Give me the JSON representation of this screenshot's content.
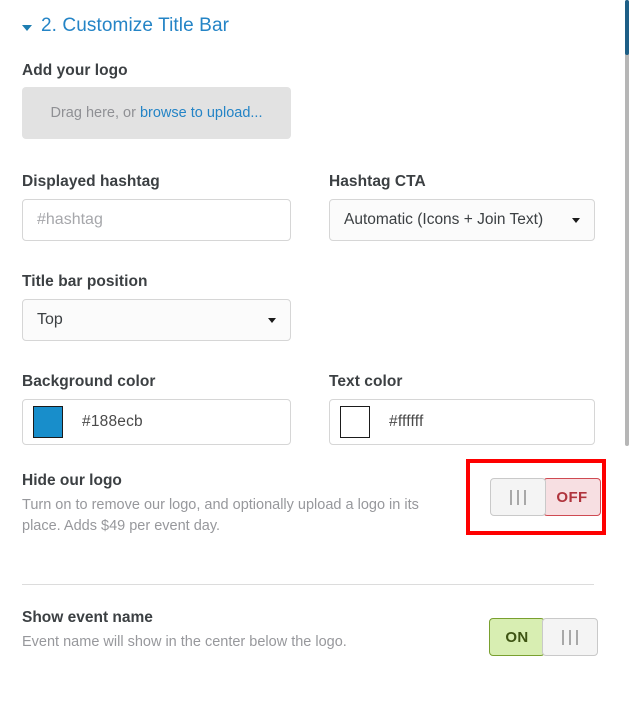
{
  "section": {
    "title": "2. Customize Title Bar",
    "collapse_icon": "caret-down-icon",
    "accent_color": "#2484c6"
  },
  "logo_upload": {
    "label": "Add your logo",
    "prompt_text": "Drag here, or ",
    "link_text": "browse to upload...",
    "background_color": "#e2e2e2"
  },
  "fields": {
    "hashtag": {
      "label": "Displayed hashtag",
      "value": "",
      "placeholder": "#hashtag"
    },
    "hashtag_cta": {
      "label": "Hashtag CTA",
      "value": "Automatic (Icons + Join Text)",
      "options": [
        "Automatic (Icons + Join Text)"
      ]
    },
    "title_bar_position": {
      "label": "Title bar position",
      "value": "Top",
      "options": [
        "Top"
      ]
    },
    "background_color": {
      "label": "Background color",
      "value": "#188ecb",
      "swatch_color": "#188ecb"
    },
    "text_color": {
      "label": "Text color",
      "value": "#ffffff",
      "swatch_color": "#ffffff"
    }
  },
  "toggles": {
    "hide_logo": {
      "title": "Hide our logo",
      "description": "Turn on to remove our logo, and optionally upload a logo in its place. Adds $49 per event day.",
      "state_label": "OFF",
      "state": "off",
      "handle_icon": "grip-handle-icon",
      "off_color": "#f7dfe2",
      "highlighted": true,
      "highlight_color": "#fe0000"
    },
    "show_event_name": {
      "title": "Show event name",
      "description": "Event name will show in the center below the logo.",
      "state_label": "ON",
      "state": "on",
      "handle_icon": "grip-handle-icon",
      "on_color": "#d8eeb2"
    }
  },
  "scrollbar": {
    "thumb_color": "#1e5f86",
    "track_color": "#b6b6b6"
  }
}
